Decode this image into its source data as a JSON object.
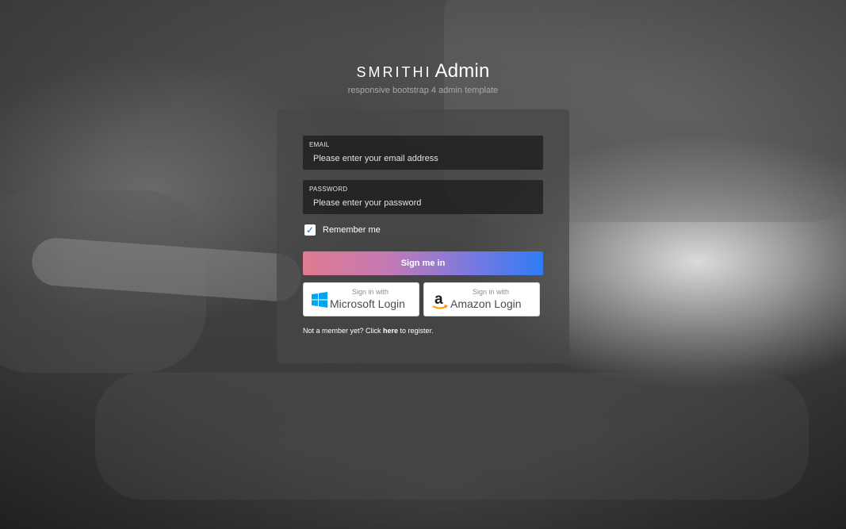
{
  "brand": {
    "name_small": "SMRITHI",
    "name_large": "Admin",
    "tagline": "responsive bootstrap 4 admin template"
  },
  "form": {
    "email": {
      "label": "EMAIL",
      "placeholder": "Please enter your email address",
      "value": ""
    },
    "password": {
      "label": "PASSWORD",
      "placeholder": "Please enter your password",
      "value": ""
    },
    "remember": {
      "label": "Remember me",
      "checked": true
    },
    "submit_label": "Sign me in"
  },
  "social": {
    "microsoft": {
      "small": "Sign in with",
      "large": "Microsoft Login",
      "icon": "windows-icon"
    },
    "amazon": {
      "small": "Sign in with",
      "large": "Amazon Login",
      "icon": "amazon-icon"
    }
  },
  "register": {
    "prefix": "Not a member yet? Click ",
    "link": "here",
    "suffix": " to register."
  },
  "colors": {
    "button_gradient_start": "#e07a8f",
    "button_gradient_end": "#2f7cf5",
    "windows_blue": "#00a4ef",
    "checkbox_accent": "#2a63b6"
  }
}
